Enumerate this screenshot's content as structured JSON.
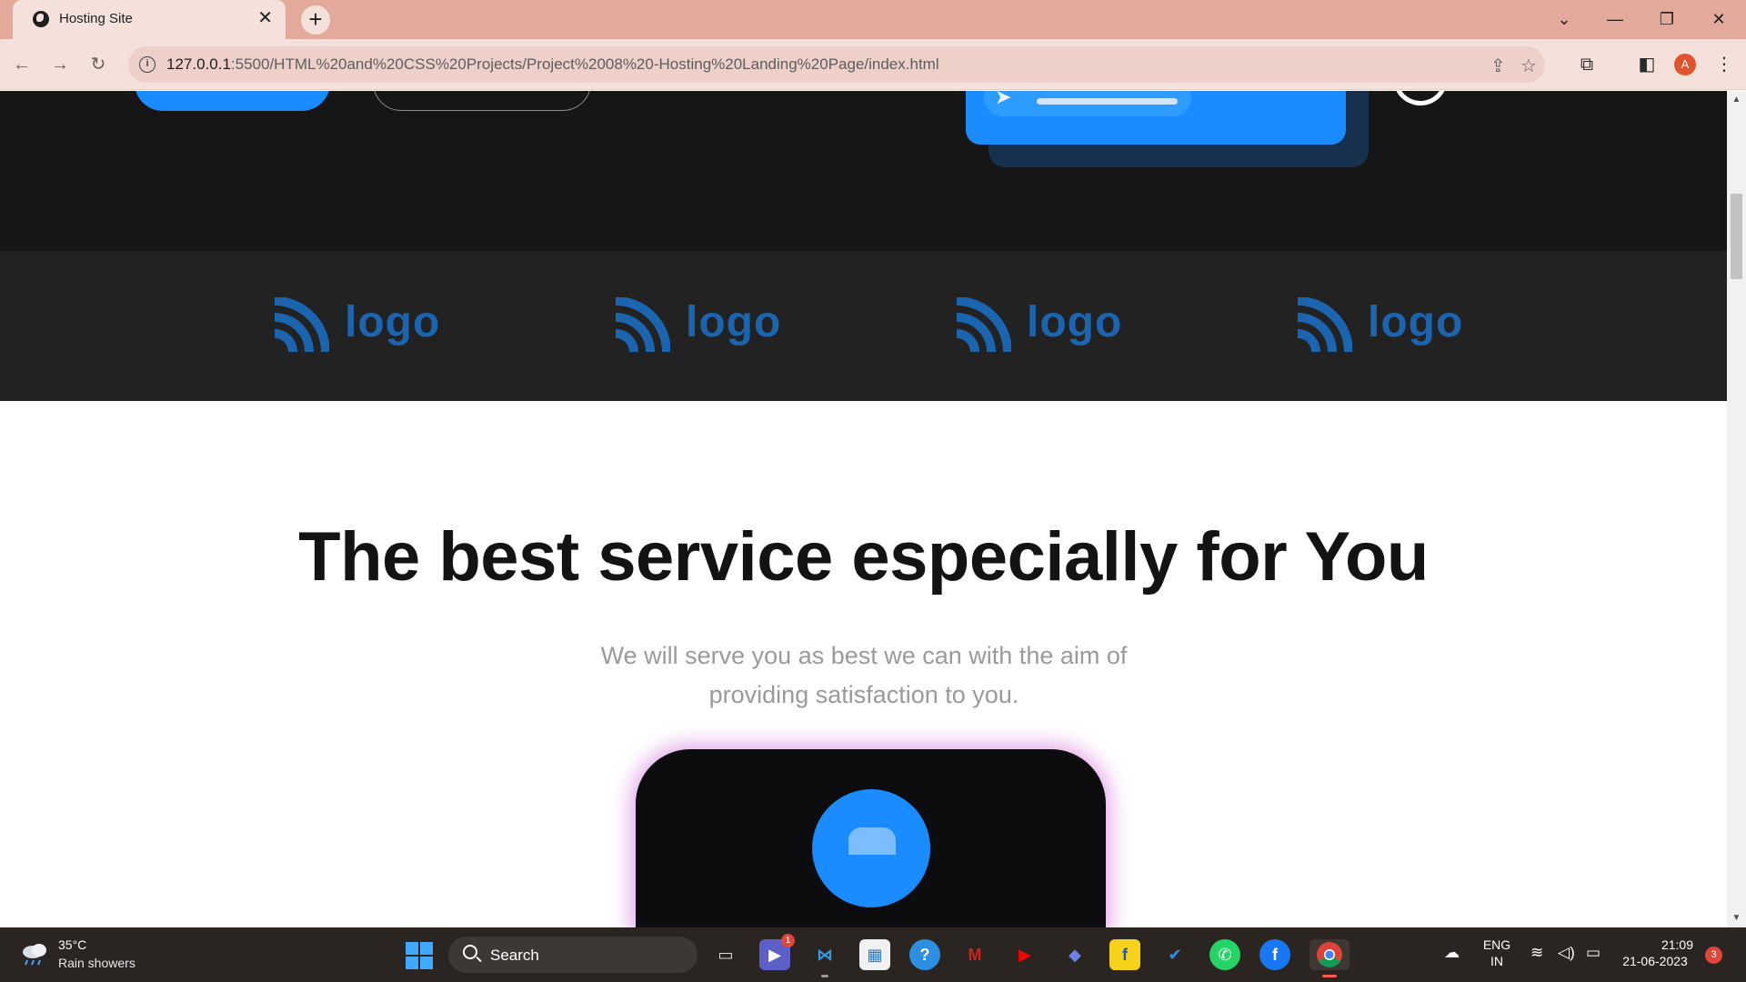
{
  "browser": {
    "tab_title": "Hosting Site",
    "tab_close": "✕",
    "new_tab": "+",
    "url_host": "127.0.0.1",
    "url_rest": ":5500/HTML%20and%20CSS%20Projects/Project%2008%20-Hosting%20Landing%20Page/index.html",
    "profile_initial": "A",
    "window_controls": {
      "dropdown": "⌄",
      "minimize": "—",
      "restore": "❐",
      "close": "✕"
    }
  },
  "page": {
    "partner_logos": [
      {
        "text": "logo"
      },
      {
        "text": "logo"
      },
      {
        "text": "logo"
      },
      {
        "text": "logo"
      }
    ],
    "service": {
      "title": "The best service especially for You",
      "subtitle": "We will serve you as best we can with the aim of providing satisfaction to you."
    },
    "colors": {
      "accent": "#1a8cff",
      "dark": "#161616",
      "logo_strip": "#222223",
      "logo_blue": "#1a64b0"
    }
  },
  "taskbar": {
    "weather_temp": "35°C",
    "weather_desc": "Rain showers",
    "search_label": "Search",
    "teams_badge": "1",
    "language_line1": "ENG",
    "language_line2": "IN",
    "time": "21:09",
    "date": "21-06-2023",
    "notification_count": "3"
  }
}
